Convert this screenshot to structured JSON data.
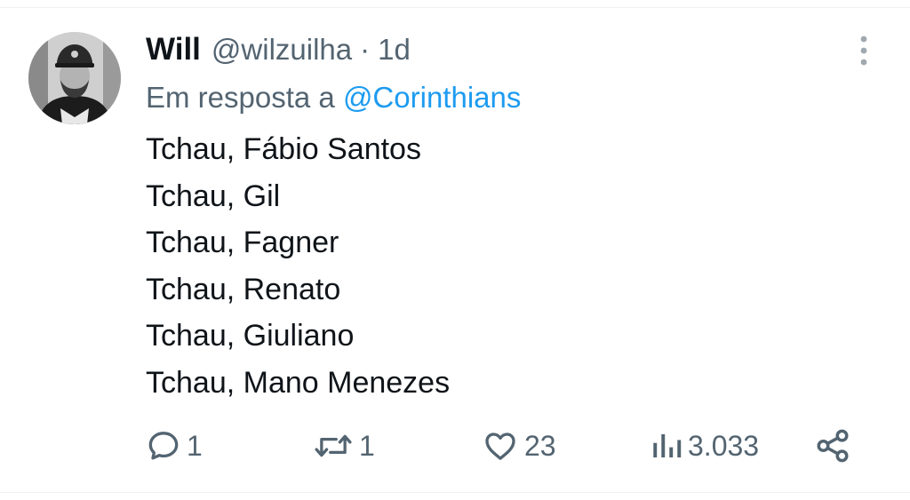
{
  "tweet": {
    "author_name": "Will",
    "author_handle": "@wilzuilha",
    "separator": "·",
    "time": "1d",
    "reply_prefix": "Em resposta a",
    "reply_to": "@Corinthians",
    "lines": [
      "Tchau, Fábio Santos",
      "Tchau, Gil",
      "Tchau, Fagner",
      "Tchau, Renato",
      "Tchau, Giuliano",
      "Tchau, Mano Menezes"
    ],
    "stats": {
      "replies": "1",
      "retweets": "1",
      "likes": "23",
      "views": "3.033"
    }
  },
  "colors": {
    "text": "#0f1419",
    "secondary": "#536471",
    "link": "#1d9bf0",
    "divider": "#eff3f4"
  },
  "icons": {
    "more": "more-vertical-icon",
    "reply": "reply-icon",
    "retweet": "retweet-icon",
    "like": "heart-icon",
    "views": "views-icon",
    "share": "share-icon"
  }
}
